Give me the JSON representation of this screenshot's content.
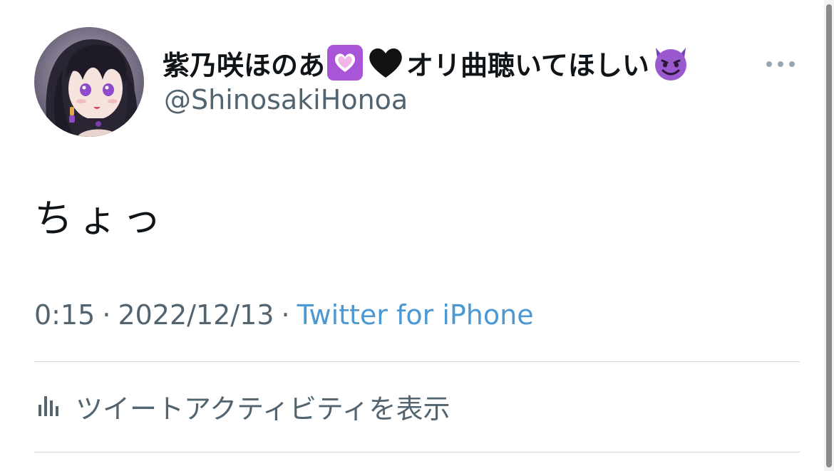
{
  "tweet": {
    "author": {
      "name_part1": "紫乃咲ほのあ",
      "name_part2": "オリ曲聴いてほしい",
      "handle": "@ShinosakiHonoa",
      "name_emojis": [
        "purple-heart-emoji",
        "black-heart-emoji",
        "smiling-imp-emoji"
      ]
    },
    "text": "ちょっ",
    "meta": {
      "time": "0:15",
      "separator": "·",
      "date": "2022/12/13",
      "source": "Twitter for iPhone"
    },
    "activity": {
      "label": "ツイートアクティビティを表示",
      "icon": "bar-chart-icon"
    }
  },
  "icons": {
    "more": "more-dots-icon"
  },
  "colors": {
    "text_primary": "#0f1419",
    "text_secondary": "#536471",
    "link": "#4b98d3",
    "divider": "#cfd9de",
    "emoji_purple": "#a855d8",
    "emoji_imp": "#9b59d0"
  }
}
